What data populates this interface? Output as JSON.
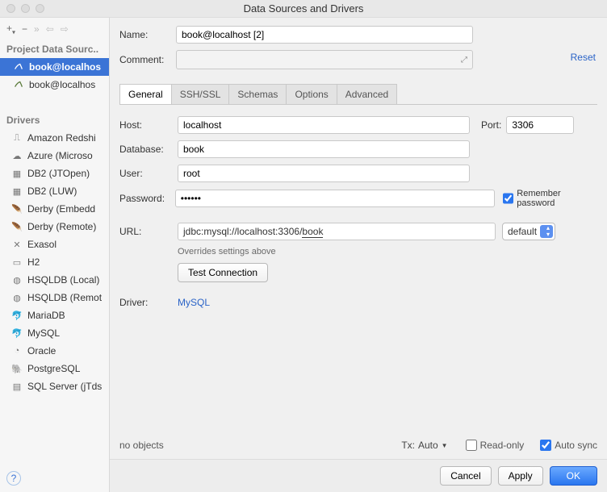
{
  "title": "Data Sources and Drivers",
  "reset_label": "Reset",
  "sidebar": {
    "section1": "Project Data Sourc..",
    "items": [
      {
        "label": "book@localhos"
      },
      {
        "label": "book@localhos"
      }
    ],
    "section2": "Drivers",
    "drivers": [
      "Amazon Redshi",
      "Azure (Microso",
      "DB2 (JTOpen)",
      "DB2 (LUW)",
      "Derby (Embedd",
      "Derby (Remote)",
      "Exasol",
      "H2",
      "HSQLDB (Local)",
      "HSQLDB (Remot",
      "MariaDB",
      "MySQL",
      "Oracle",
      "PostgreSQL",
      "SQL Server (jTds"
    ]
  },
  "fields": {
    "name_label": "Name:",
    "name_value": "book@localhost [2]",
    "comment_label": "Comment:"
  },
  "tabs": [
    "General",
    "SSH/SSL",
    "Schemas",
    "Options",
    "Advanced"
  ],
  "form": {
    "host_label": "Host:",
    "host_value": "localhost",
    "port_label": "Port:",
    "port_value": "3306",
    "db_label": "Database:",
    "db_value": "book",
    "user_label": "User:",
    "user_value": "root",
    "pwd_label": "Password:",
    "pwd_value": "••••••",
    "remember_label": "Remember password",
    "remember_checked": true,
    "url_label": "URL:",
    "url_prefix": "jdbc:mysql://localhost:3306/",
    "url_suffix": "book",
    "url_hint": "Overrides settings above",
    "select_value": "default",
    "test_label": "Test Connection",
    "driver_label": "Driver:",
    "driver_value": "MySQL"
  },
  "footer": {
    "no_objects": "no objects",
    "tx_label": "Tx:",
    "tx_value": "Auto",
    "readonly_label": "Read-only",
    "readonly_checked": false,
    "autosync_label": "Auto sync",
    "autosync_checked": true
  },
  "buttons": {
    "cancel": "Cancel",
    "apply": "Apply",
    "ok": "OK"
  }
}
